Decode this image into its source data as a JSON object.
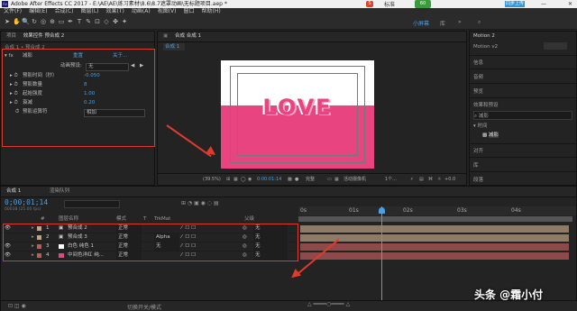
{
  "titlebar": {
    "title": "Adobe After Effects CC 2017 - E:\\AE\\AE\\练习素材\\8.6\\8.7遮罩动画\\无标题项目.aep *"
  },
  "menubar": {
    "items": [
      "文件(F)",
      "编辑(E)",
      "合成(C)",
      "图层(L)",
      "效果(T)",
      "动画(A)",
      "视图(V)",
      "窗口",
      "帮助(H)"
    ]
  },
  "toolbar": {
    "workspaces": [
      "标准",
      "小屏幕",
      "库"
    ],
    "sync_label": "同步上传",
    "speed_label": "点我加速",
    "badge": "60"
  },
  "effects_panel": {
    "tabs": [
      "项目",
      "效果控件 预合成 2"
    ],
    "breadcrumb": "合成 1 • 预合成 2",
    "effect_name": "减影",
    "reset_label": "重置",
    "about_label": "关于...",
    "anim_preset_label": "动画预设:",
    "anim_preset_value": "无",
    "props": [
      {
        "name": "预影时间（秒）",
        "value": "-0.050"
      },
      {
        "name": "预影数量",
        "value": "8"
      },
      {
        "name": "起始强度",
        "value": "1.00"
      },
      {
        "name": "衰减",
        "value": "0.20"
      },
      {
        "name": "预影运算符",
        "value": "相加"
      }
    ]
  },
  "comp_panel": {
    "tab": "合成 合成 1",
    "sub_tab": "合成 1",
    "canvas_text": "LOVE",
    "bottom": {
      "zoom": "(39.5%)",
      "time": "0:00:01:14",
      "quality": "完整",
      "camera": "活动摄像机",
      "views": "1个...",
      "offset": "+0.0"
    }
  },
  "right_panel": {
    "items": [
      "Motion 2",
      "Motion v2",
      "信息",
      "音频",
      "预览",
      "效果和预设",
      "对齐",
      "库",
      "段落"
    ],
    "search_value": "减影",
    "tree": [
      "▾ 时间",
      "减影"
    ]
  },
  "timeline": {
    "tabs": [
      "合成 1",
      "渲染队列"
    ],
    "timecode": "0;00;01;14",
    "frame_info": "00038 (25.00 fps)",
    "headers": [
      "#",
      "图层名称",
      "模式",
      "T",
      "TrkMat",
      "父级"
    ],
    "ruler": [
      "0s",
      "01s",
      "02s",
      "03s",
      "04s"
    ],
    "layers": [
      {
        "num": "1",
        "name": "预合成 2",
        "mode": "正常",
        "trkmat": "",
        "parent": "无",
        "color": "#c8a27a"
      },
      {
        "num": "2",
        "name": "预合成 3",
        "mode": "正常",
        "trkmat": "Alpha",
        "parent": "无",
        "color": "#c8a27a"
      },
      {
        "num": "3",
        "name": "白色 纯色 1",
        "mode": "正常",
        "trkmat": "无",
        "parent": "无",
        "color": "#c05a5a"
      },
      {
        "num": "4",
        "name": "中间色洋红 纯...",
        "mode": "正常",
        "trkmat": "",
        "parent": "无",
        "color": "#c05a5a"
      }
    ],
    "footer": "切换开关/模式"
  },
  "watermark": "头条 @霜小付",
  "colors": {
    "highlight": "#e03a2c",
    "pink": "#e8447f",
    "accent": "#4a9fe6"
  }
}
